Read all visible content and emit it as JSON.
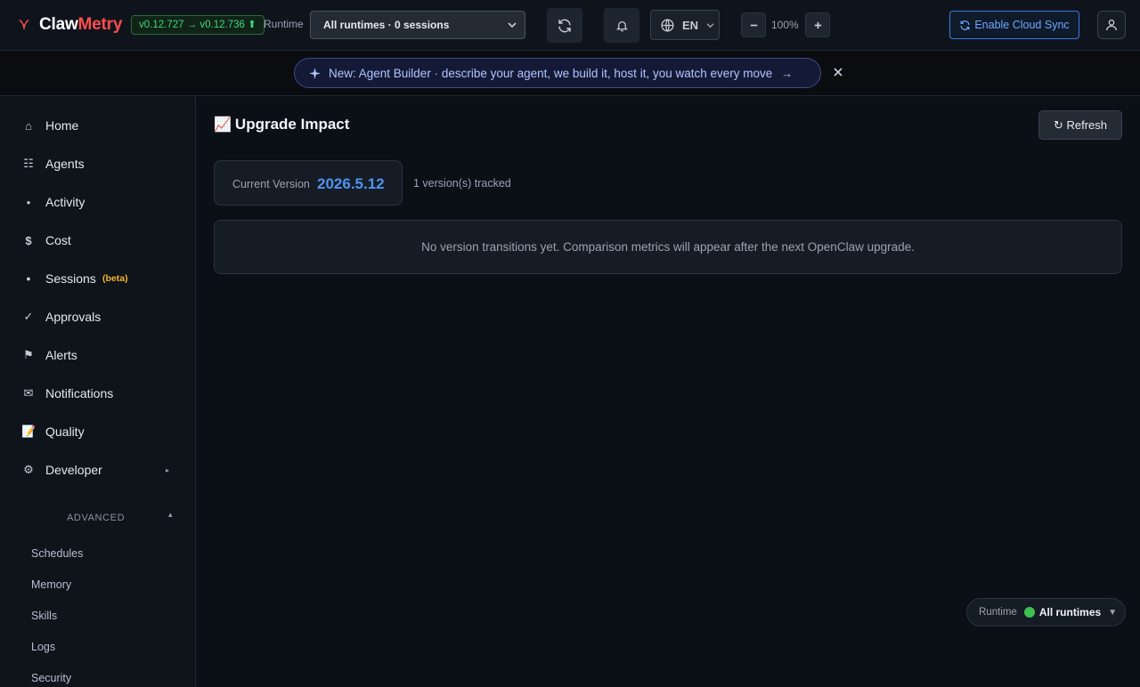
{
  "header": {
    "brand_part1": "Claw",
    "brand_part2": "Metry",
    "brand_color": "#ff4d4d",
    "version_badge": "v0.12.727 → v0.12.736 ⬆",
    "runtime_label": "Runtime",
    "runtime_select_value": "All runtimes · 0 sessions",
    "language": "EN",
    "zoom": "100%",
    "cloud_sync_label": "Enable Cloud Sync",
    "icons": [
      "refresh-icon",
      "bell-icon",
      "globe-icon",
      "minus-icon",
      "plus-icon",
      "sync-icon",
      "user-icon"
    ]
  },
  "announcement": {
    "text": "New: Agent Builder · describe your agent, we build it, host it, you watch every move",
    "arrow": "→",
    "accent_color": "#b3c3ff"
  },
  "sidebar": {
    "items": [
      {
        "label": "Home",
        "icon": "⌂"
      },
      {
        "label": "Agents",
        "icon": "☷"
      },
      {
        "label": "Activity",
        "icon": "●"
      },
      {
        "label": "Cost",
        "icon": "$"
      },
      {
        "label": "Sessions",
        "icon": "●",
        "badge": "(beta)"
      },
      {
        "label": "Approvals",
        "icon": "✓"
      },
      {
        "label": "Alerts",
        "icon": "⚑"
      },
      {
        "label": "Notifications",
        "icon": "✉"
      },
      {
        "label": "Quality",
        "icon": "📝"
      },
      {
        "label": "Developer",
        "icon": "⚙",
        "caret": "▸"
      }
    ],
    "advanced": {
      "label": "ADVANCED",
      "caret": "▴",
      "items": [
        "Schedules",
        "Memory",
        "Skills",
        "Logs",
        "Security"
      ]
    }
  },
  "main": {
    "title_emoji": "📈",
    "title": "Upgrade Impact",
    "refresh_label": "↻ Refresh",
    "current_version_label": "Current Version",
    "current_version_value": "2026.5.12",
    "tracked_text": "1 version(s) tracked",
    "empty_message": "No version transitions yet. Comparison metrics will appear after the next OpenClaw upgrade.",
    "runtime_float": {
      "label": "Runtime",
      "value": "All runtimes",
      "status_color": "#3fbf4f",
      "caret": "▼"
    }
  }
}
